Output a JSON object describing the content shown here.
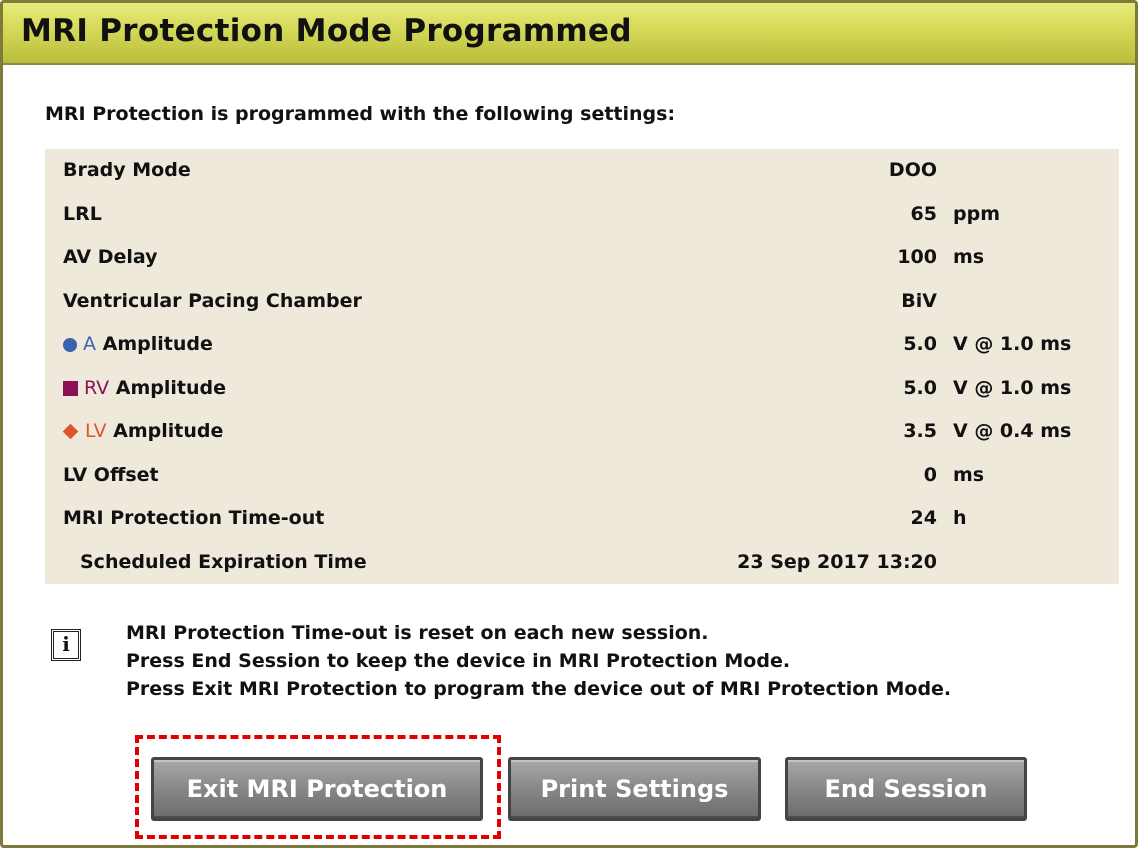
{
  "window": {
    "title": "MRI Protection Mode Programmed"
  },
  "intro": "MRI Protection is programmed with the following settings:",
  "settings": [
    {
      "label": "Brady Mode",
      "value": "DOO",
      "unit": ""
    },
    {
      "label": "LRL",
      "value": "65",
      "unit": "ppm"
    },
    {
      "label": "AV Delay",
      "value": "100",
      "unit": "ms"
    },
    {
      "label": "Ventricular Pacing Chamber",
      "value": "BiV",
      "unit": ""
    },
    {
      "label": "Amplitude",
      "channel": "A",
      "marker": "circle-icon",
      "value": "5.0",
      "unit": "V @ 1.0 ms"
    },
    {
      "label": "Amplitude",
      "channel": "RV",
      "marker": "square-icon",
      "value": "5.0",
      "unit": "V @ 1.0 ms"
    },
    {
      "label": "Amplitude",
      "channel": "LV",
      "marker": "diamond-icon",
      "value": "3.5",
      "unit": "V @ 0.4 ms"
    },
    {
      "label": "LV Offset",
      "value": "0",
      "unit": "ms"
    },
    {
      "label": "MRI Protection Time-out",
      "value": "24",
      "unit": "h"
    },
    {
      "label": "Scheduled Expiration Time",
      "value": "23 Sep 2017 13:20",
      "unit": ""
    }
  ],
  "info": {
    "icon": "info-icon",
    "lines": [
      "MRI Protection Time-out is reset on each new session.",
      "Press End Session to keep the device in MRI Protection Mode.",
      "Press Exit MRI Protection to program the device out of MRI Protection Mode."
    ]
  },
  "buttons": {
    "exit": "Exit MRI Protection",
    "print": "Print Settings",
    "end": "End Session"
  },
  "colors": {
    "titlebar": "#d4d857",
    "row_alt": "#eee9db",
    "channel_a": "#3a63ad",
    "channel_rv": "#8b1258",
    "channel_lv": "#e0542b",
    "focus_highlight": "#e00000"
  }
}
